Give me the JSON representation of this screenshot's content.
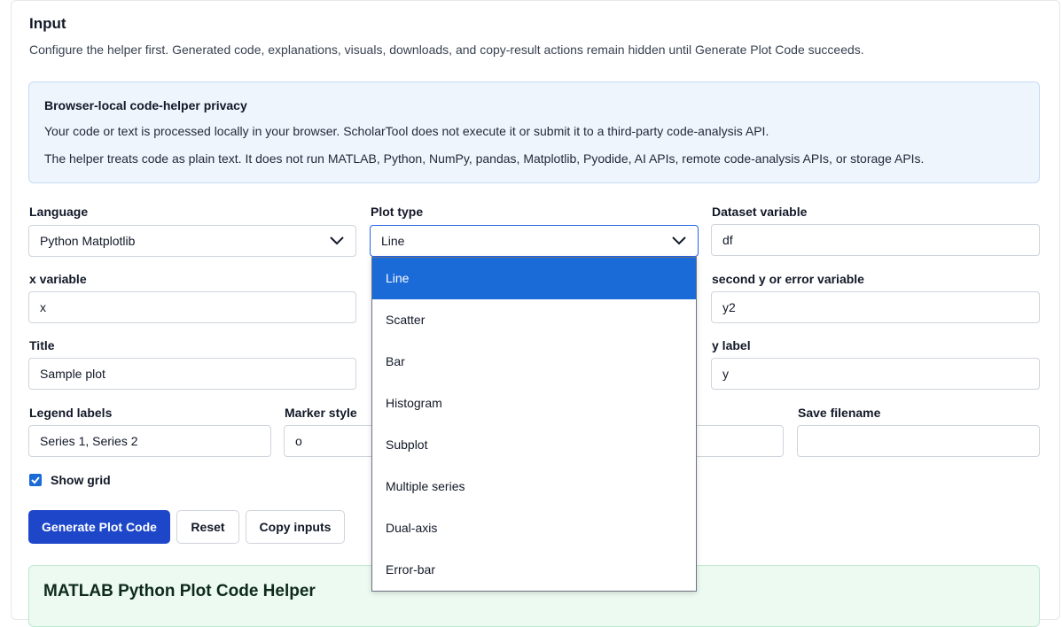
{
  "section": {
    "title": "Input",
    "description": "Configure the helper first. Generated code, explanations, visuals, downloads, and copy-result actions remain hidden until Generate Plot Code succeeds."
  },
  "privacy": {
    "title": "Browser-local code-helper privacy",
    "line1": "Your code or text is processed locally in your browser. ScholarTool does not execute it or submit it to a third-party code-analysis API.",
    "line2": "The helper treats code as plain text. It does not run MATLAB, Python, NumPy, pandas, Matplotlib, Pyodide, AI APIs, remote code-analysis APIs, or storage APIs."
  },
  "fields": {
    "language": {
      "label": "Language",
      "value": "Python Matplotlib"
    },
    "plot_type": {
      "label": "Plot type",
      "value": "Line"
    },
    "dataset_variable": {
      "label": "Dataset variable",
      "value": "df"
    },
    "x_variable": {
      "label": "x variable",
      "value": "x"
    },
    "second_y": {
      "label": "second y or error variable",
      "value": "y2"
    },
    "title": {
      "label": "Title",
      "value": "Sample plot"
    },
    "y_label": {
      "label": "y label",
      "value": "y"
    },
    "legend_labels": {
      "label": "Legend labels",
      "value": "Series 1, Series 2"
    },
    "marker_style": {
      "label": "Marker style",
      "value": "o"
    },
    "save_filename": {
      "label": "Save filename",
      "value": ""
    }
  },
  "dropdown": {
    "options": [
      "Line",
      "Scatter",
      "Bar",
      "Histogram",
      "Subplot",
      "Multiple series",
      "Dual-axis",
      "Error-bar"
    ],
    "selected": "Line"
  },
  "show_grid": {
    "label": "Show grid",
    "checked": true
  },
  "buttons": {
    "generate": "Generate Plot Code",
    "reset": "Reset",
    "copy_inputs": "Copy inputs"
  },
  "result": {
    "title": "MATLAB Python Plot Code Helper"
  },
  "colors": {
    "accent": "#1a6ad7",
    "primary_button": "#1d46c8",
    "privacy_bg": "#eef5fd",
    "result_bg": "#ecfaf1"
  }
}
